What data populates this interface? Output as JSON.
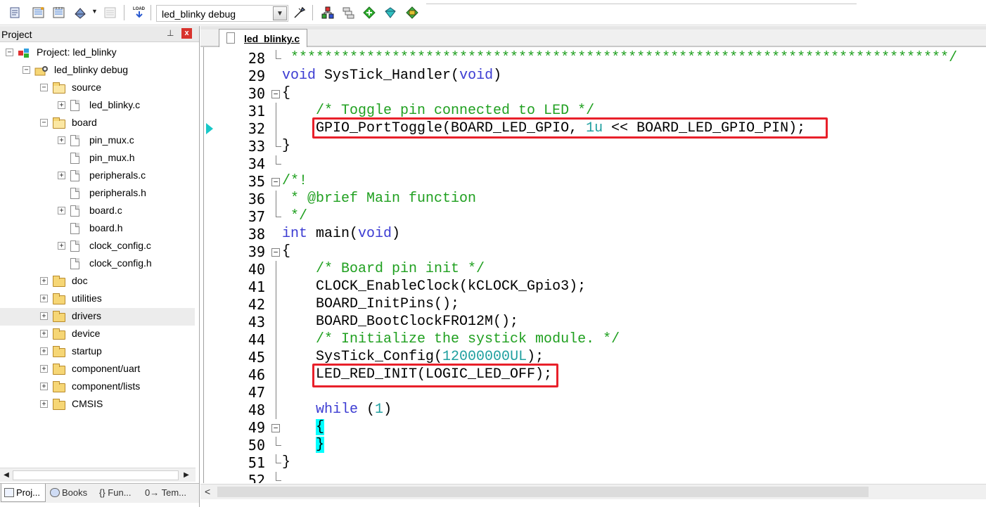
{
  "toolbar": {
    "target_select": "led_blinky debug",
    "load_label": "LOAD"
  },
  "project_panel": {
    "title": "Project",
    "pin_glyph": "⊥",
    "close_glyph": "x",
    "tree": [
      {
        "label": "Project: led_blinky",
        "exp": "−"
      },
      {
        "label": "led_blinky debug",
        "exp": "−"
      },
      {
        "label": "source",
        "exp": "−"
      },
      {
        "label": "led_blinky.c",
        "exp": "+"
      },
      {
        "label": "board",
        "exp": "−"
      },
      {
        "label": "pin_mux.c",
        "exp": "+"
      },
      {
        "label": "pin_mux.h",
        "exp": ""
      },
      {
        "label": "peripherals.c",
        "exp": "+"
      },
      {
        "label": "peripherals.h",
        "exp": ""
      },
      {
        "label": "board.c",
        "exp": "+"
      },
      {
        "label": "board.h",
        "exp": ""
      },
      {
        "label": "clock_config.c",
        "exp": "+"
      },
      {
        "label": "clock_config.h",
        "exp": ""
      },
      {
        "label": "doc",
        "exp": "+"
      },
      {
        "label": "utilities",
        "exp": "+"
      },
      {
        "label": "drivers",
        "exp": "+"
      },
      {
        "label": "device",
        "exp": "+"
      },
      {
        "label": "startup",
        "exp": "+"
      },
      {
        "label": "component/uart",
        "exp": "+"
      },
      {
        "label": "component/lists",
        "exp": "+"
      },
      {
        "label": "CMSIS",
        "exp": "+"
      }
    ],
    "bottom_tabs": [
      "Proj...",
      "Books",
      "{} Fun...",
      "0→ Tem..."
    ]
  },
  "editor": {
    "active_tab": "led_blinky.c",
    "lines": [
      {
        "n": "28",
        "text": " ******************************************************************************/"
      },
      {
        "n": "29",
        "text": "void SysTick_Handler(void)"
      },
      {
        "n": "30",
        "text": "{"
      },
      {
        "n": "31",
        "text": "    /* Toggle pin connected to LED */"
      },
      {
        "n": "32",
        "text": "    GPIO_PortToggle(BOARD_LED_GPIO, 1u << BOARD_LED_GPIO_PIN);"
      },
      {
        "n": "33",
        "text": "}"
      },
      {
        "n": "34",
        "text": ""
      },
      {
        "n": "35",
        "text": "/*!"
      },
      {
        "n": "36",
        "text": " * @brief Main function"
      },
      {
        "n": "37",
        "text": " */"
      },
      {
        "n": "38",
        "text": "int main(void)"
      },
      {
        "n": "39",
        "text": "{"
      },
      {
        "n": "40",
        "text": "    /* Board pin init */"
      },
      {
        "n": "41",
        "text": "    CLOCK_EnableClock(kCLOCK_Gpio3);"
      },
      {
        "n": "42",
        "text": "    BOARD_InitPins();"
      },
      {
        "n": "43",
        "text": "    BOARD_BootClockFRO12M();"
      },
      {
        "n": "44",
        "text": "    /* Initialize the systick module. */"
      },
      {
        "n": "45",
        "text": "    SysTick_Config(12000000UL);"
      },
      {
        "n": "46",
        "text": "    LED_RED_INIT(LOGIC_LED_OFF);"
      },
      {
        "n": "47",
        "text": ""
      },
      {
        "n": "48",
        "text": "    while (1)"
      },
      {
        "n": "49",
        "text": "    {"
      },
      {
        "n": "50",
        "text": "    }"
      },
      {
        "n": "51",
        "text": "}"
      },
      {
        "n": "52",
        "text": ""
      }
    ]
  },
  "colors": {
    "keyword": "#3c3cd2",
    "comment": "#20a020",
    "number": "#20a0a0",
    "brace_match": "#00ffff",
    "highlight_box": "#e8202a",
    "current_line_arrow": "#18c8c8"
  }
}
